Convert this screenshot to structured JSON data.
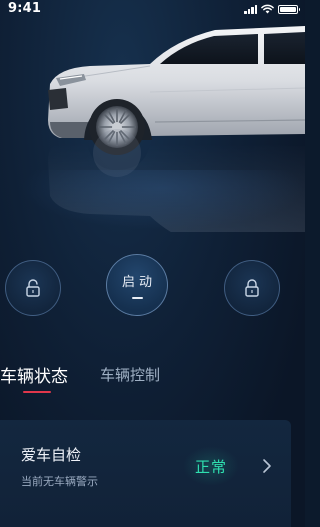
{
  "status_bar": {
    "time": "9:41",
    "battery_level": 1.0
  },
  "controls": {
    "left_icon": "unlock-icon",
    "center_label": "启动",
    "right_icon": "lock-icon"
  },
  "tabs": [
    {
      "label": "车辆状态",
      "active": true
    },
    {
      "label": "车辆控制",
      "active": false
    }
  ],
  "self_check_card": {
    "title": "爱车自检",
    "subtitle": "当前无车辆警示",
    "status": "正常",
    "status_color": "#2fe0b0"
  },
  "colors": {
    "background": "#0c1a2c",
    "tab_underline": "#e0374b",
    "card": "#13273f"
  }
}
